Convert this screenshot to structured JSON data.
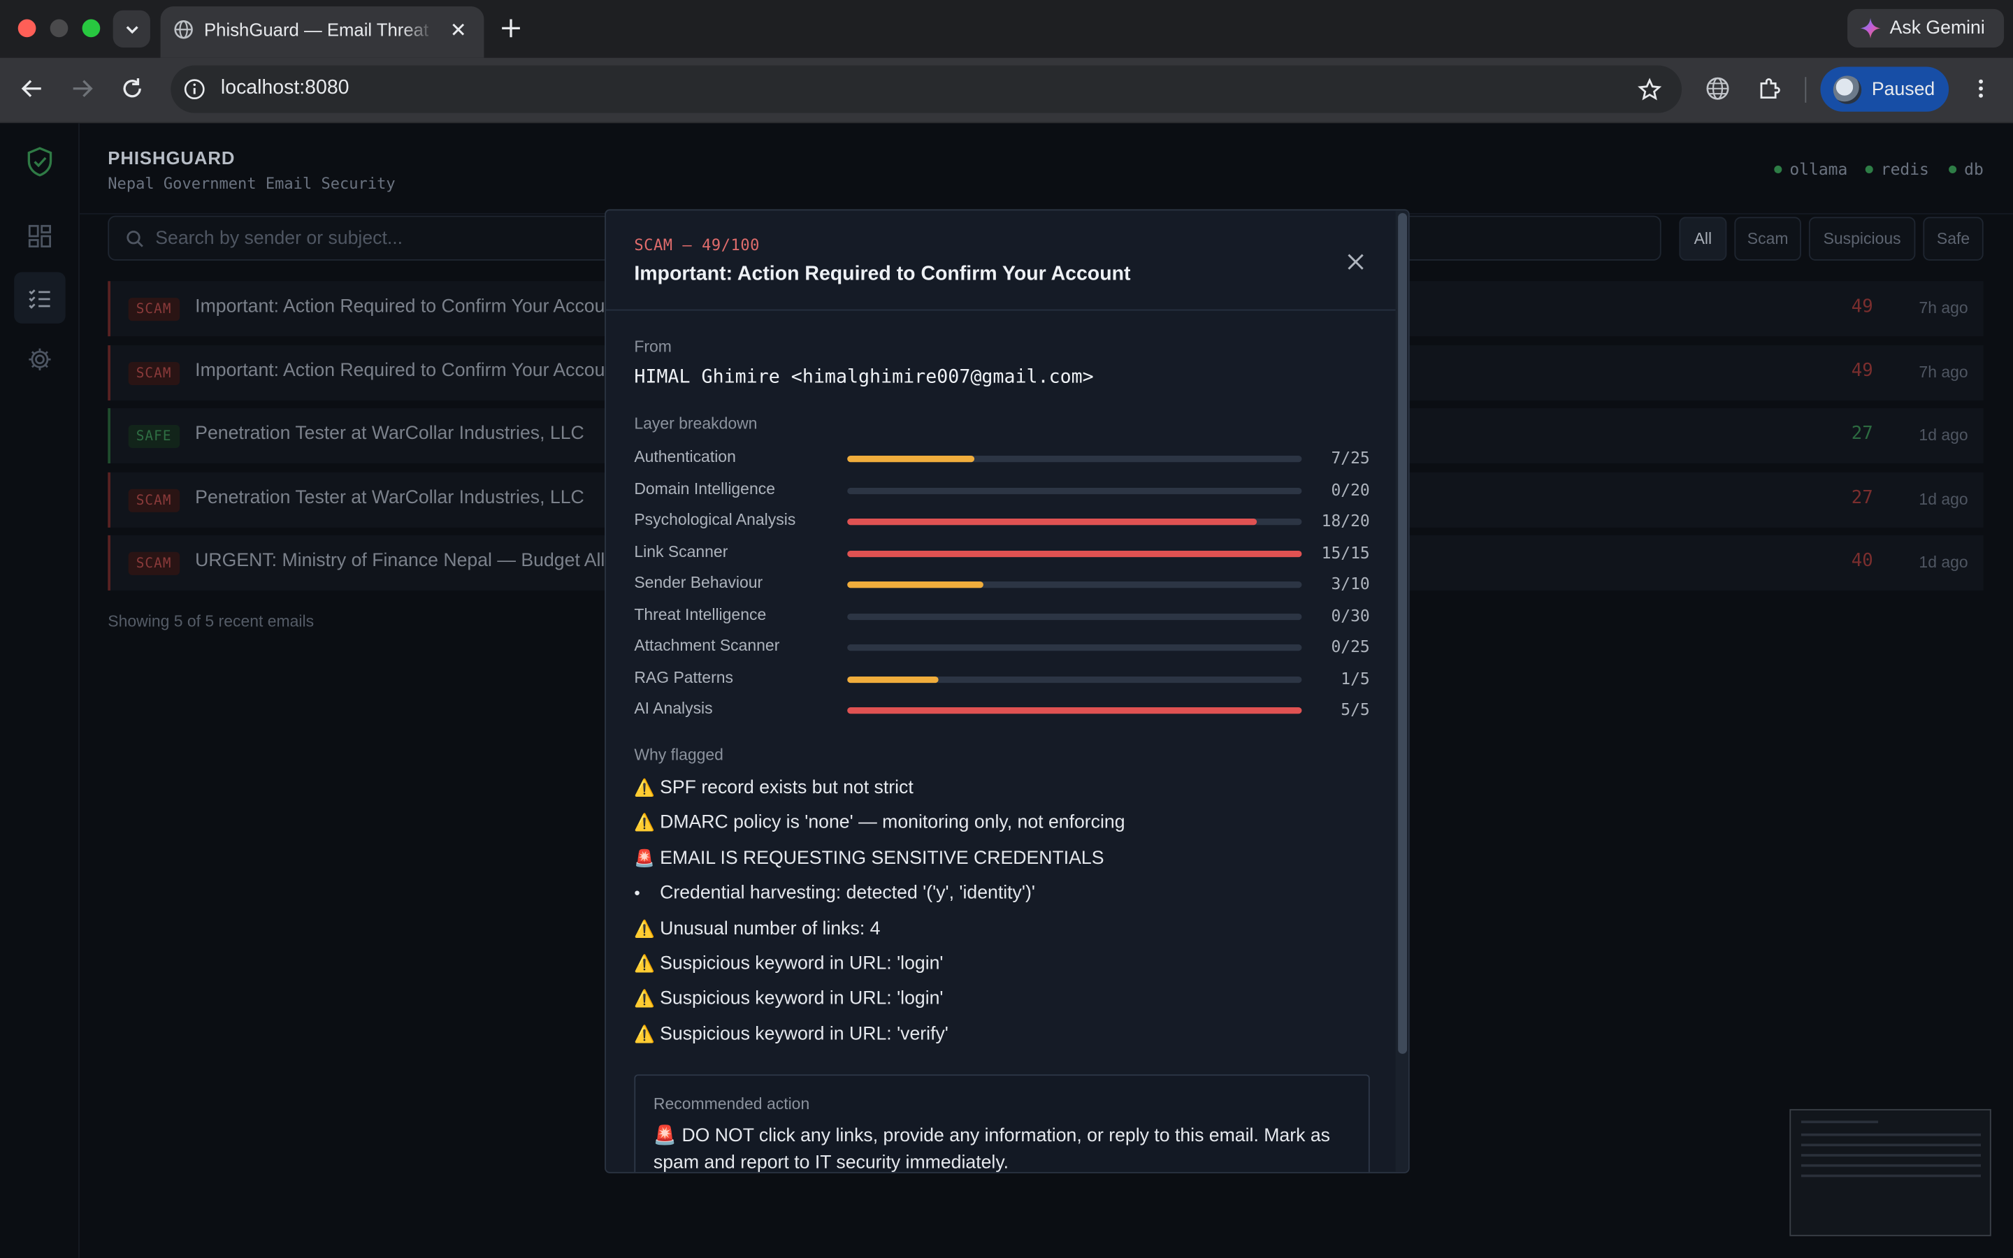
{
  "browser": {
    "tab_title": "PhishGuard — Email Threat Dashboard",
    "url": "localhost:8080",
    "ask_gemini": "Ask Gemini",
    "profile_status": "Paused"
  },
  "app": {
    "brand": "PHISHGUARD",
    "subtitle": "Nepal Government Email Security",
    "services": [
      "ollama",
      "redis",
      "db"
    ],
    "search_placeholder": "Search by sender or subject...",
    "filters": [
      "All",
      "Scam",
      "Suspicious",
      "Safe"
    ],
    "active_filter": "All",
    "emails": [
      {
        "badge": "SCAM",
        "subject": "Important: Action Required to Confirm Your Account",
        "score": "49",
        "time": "7h ago"
      },
      {
        "badge": "SCAM",
        "subject": "Important: Action Required to Confirm Your Account",
        "score": "49",
        "time": "7h ago"
      },
      {
        "badge": "SAFE",
        "subject": "Penetration Tester at WarCollar Industries, LLC",
        "score": "27",
        "time": "1d ago"
      },
      {
        "badge": "SCAM",
        "subject": "Penetration Tester at WarCollar Industries, LLC",
        "score": "27",
        "time": "1d ago"
      },
      {
        "badge": "SCAM",
        "subject": "URGENT: Ministry of Finance Nepal — Budget Allocation",
        "score": "40",
        "time": "1d ago"
      }
    ],
    "showing": "Showing 5 of 5 recent emails"
  },
  "modal": {
    "kicker": "SCAM — 49/100",
    "title": "Important: Action Required to Confirm Your Account",
    "from_label": "From",
    "from_value": "HIMAL Ghimire <himalghimire007@gmail.com>",
    "layers_label": "Layer breakdown",
    "layers": [
      {
        "name": "Authentication",
        "score": 7,
        "max": 25,
        "label": "7/25",
        "color": "#f0ad3c"
      },
      {
        "name": "Domain Intelligence",
        "score": 0,
        "max": 20,
        "label": "0/20",
        "color": "#f0ad3c"
      },
      {
        "name": "Psychological Analysis",
        "score": 18,
        "max": 20,
        "label": "18/20",
        "color": "#e05252"
      },
      {
        "name": "Link Scanner",
        "score": 15,
        "max": 15,
        "label": "15/15",
        "color": "#e05252"
      },
      {
        "name": "Sender Behaviour",
        "score": 3,
        "max": 10,
        "label": "3/10",
        "color": "#f0ad3c"
      },
      {
        "name": "Threat Intelligence",
        "score": 0,
        "max": 30,
        "label": "0/30",
        "color": "#f0ad3c"
      },
      {
        "name": "Attachment Scanner",
        "score": 0,
        "max": 25,
        "label": "0/25",
        "color": "#f0ad3c"
      },
      {
        "name": "RAG Patterns",
        "score": 1,
        "max": 5,
        "label": "1/5",
        "color": "#f0ad3c"
      },
      {
        "name": "AI Analysis",
        "score": 5,
        "max": 5,
        "label": "5/5",
        "color": "#e05252"
      }
    ],
    "why_label": "Why flagged",
    "reasons": [
      {
        "icon": "⚠️",
        "text": "SPF record exists but not strict"
      },
      {
        "icon": "⚠️",
        "text": "DMARC policy is 'none' — monitoring only, not enforcing"
      },
      {
        "icon": "🚨",
        "text": "EMAIL IS REQUESTING SENSITIVE CREDENTIALS"
      },
      {
        "icon": "•",
        "text": "Credential harvesting: detected '('y', 'identity')'"
      },
      {
        "icon": "⚠️",
        "text": "Unusual number of links: 4"
      },
      {
        "icon": "⚠️",
        "text": "Suspicious keyword in URL: 'login'"
      },
      {
        "icon": "⚠️",
        "text": "Suspicious keyword in URL: 'login'"
      },
      {
        "icon": "⚠️",
        "text": "Suspicious keyword in URL: 'verify'"
      }
    ],
    "recommended_label": "Recommended action",
    "recommended_text": "🚨 DO NOT click any links, provide any information, or reply to this email. Mark as spam and report to IT security immediately."
  }
}
